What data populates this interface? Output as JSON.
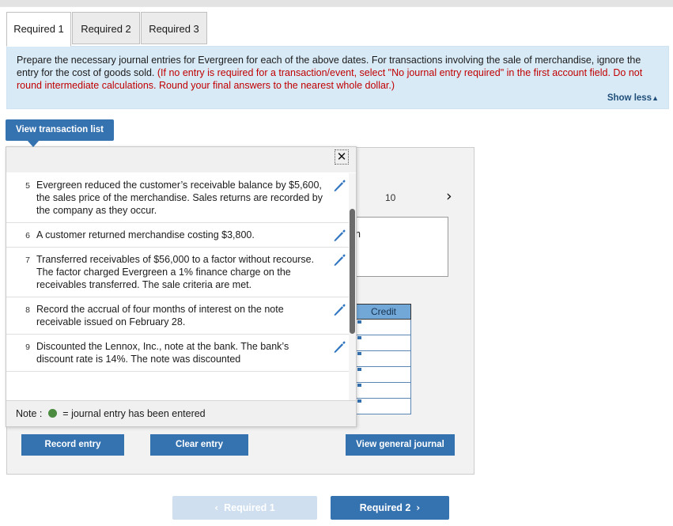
{
  "tabs": [
    {
      "label": "Required 1",
      "active": true
    },
    {
      "label": "Required 2",
      "active": false
    },
    {
      "label": "Required 3",
      "active": false
    }
  ],
  "instructions": {
    "black_part": "Prepare the necessary journal entries for Evergreen for each of the above dates. For transactions involving the sale of merchandise, ignore the entry for the cost of goods sold. ",
    "red_part": "(If no entry is required for a transaction/event, select \"No journal entry required\" in the first account field. Do not round intermediate calculations. Round your final answers to the nearest whole dollar.)",
    "show_less_label": "Show less",
    "show_less_caret": "▲"
  },
  "view_transaction_list_label": "View transaction list",
  "popup": {
    "close_label": "✕",
    "transactions": [
      {
        "num": "5",
        "text": "Evergreen reduced the customer’s receivable balance by $5,600, the sales price of the merchandise. Sales returns are recorded by the company as they occur."
      },
      {
        "num": "6",
        "text": "A customer returned merchandise costing $3,800."
      },
      {
        "num": "7",
        "text": "Transferred receivables of $56,000 to a factor without recourse. The factor charged Evergreen a 1% finance charge on the receivables transferred. The sale criteria are met."
      },
      {
        "num": "8",
        "text": "Record the accrual of four months of interest on the note receivable issued on February 28."
      },
      {
        "num": "9",
        "text": "Discounted the Lennox, Inc., note at the bank. The bank’s discount rate is 14%. The note was discounted"
      }
    ],
    "note_prefix": "Note : ",
    "note_suffix": " = journal entry has been entered"
  },
  "journal_panel": {
    "page_number": "10",
    "next_chevron": "›",
    "memo_text": "-month",
    "credit_header": "Credit",
    "credit_rows": [
      "",
      "",
      "",
      "",
      "",
      ""
    ],
    "view_general_journal_label": "View general journal"
  },
  "actions": {
    "record_entry_label": "Record entry",
    "clear_entry_label": "Clear entry"
  },
  "footer": {
    "prev_chevron": "‹",
    "prev_label": "Required 1",
    "next_label": "Required 2",
    "next_chevron": "›"
  },
  "colors": {
    "accent_blue": "#3572b0",
    "banner_blue": "#d9eaf7",
    "alert_red": "#c00000",
    "credit_header": "#72a8d8",
    "note_green": "#4a8b3f"
  }
}
